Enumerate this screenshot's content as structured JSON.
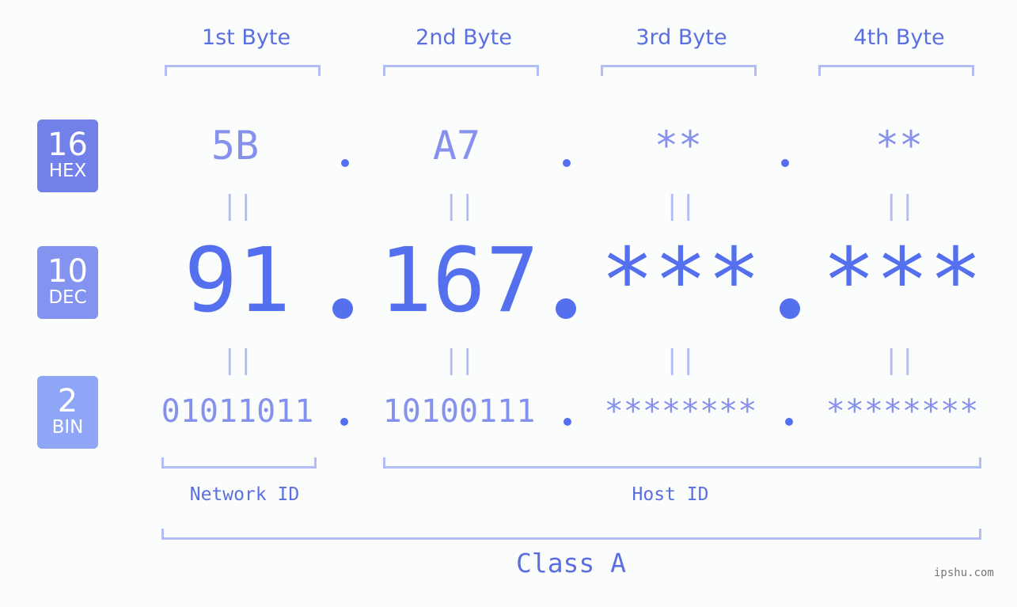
{
  "bytes": [
    {
      "title": "1st Byte",
      "hex": "5B",
      "dec": "91",
      "bin": "01011011"
    },
    {
      "title": "2nd Byte",
      "hex": "A7",
      "dec": "167",
      "bin": "10100111"
    },
    {
      "title": "3rd Byte",
      "hex": "**",
      "dec": "***",
      "bin": "********"
    },
    {
      "title": "4th Byte",
      "hex": "**",
      "dec": "***",
      "bin": "********"
    }
  ],
  "badges": {
    "hex": {
      "num": "16",
      "label": "HEX",
      "color": "#7280ea"
    },
    "dec": {
      "num": "10",
      "label": "DEC",
      "color": "#8393ef"
    },
    "bin": {
      "num": "2",
      "label": "BIN",
      "color": "#8fa6f6"
    }
  },
  "equals_symbol": "||",
  "labels": {
    "network_id": "Network ID",
    "host_id": "Host ID",
    "class": "Class A"
  },
  "watermark": "ipshu.com",
  "colors": {
    "accent": "#5570ee",
    "light_accent": "#8591ec",
    "bracket": "#b3bdf5"
  }
}
